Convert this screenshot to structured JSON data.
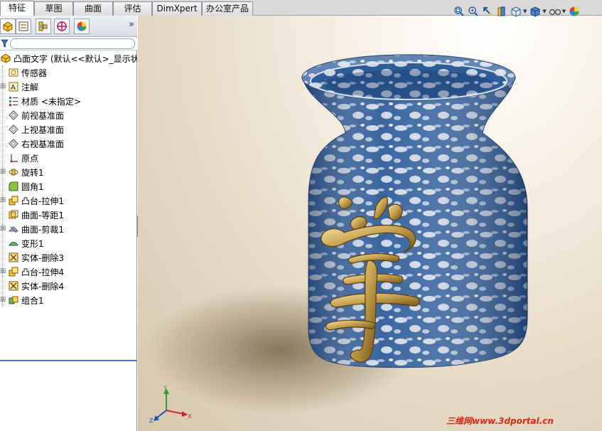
{
  "tabs": [
    {
      "label": "特征",
      "active": true
    },
    {
      "label": "草图",
      "active": false
    },
    {
      "label": "曲面",
      "active": false
    },
    {
      "label": "评估",
      "active": false
    },
    {
      "label": "DimXpert",
      "active": false
    },
    {
      "label": "办公室产品",
      "active": false
    }
  ],
  "panel": {
    "tabs": [
      "featuremanager-icon",
      "propertymanager-icon",
      "configurationmanager-icon",
      "dimxpertmanager-icon",
      "displaymanager-icon"
    ],
    "expand_label": "»"
  },
  "tree": {
    "root": "凸面文字 (默认<<默认>_显示状",
    "items": [
      {
        "label": "传感器",
        "icon": "sensor-icon"
      },
      {
        "label": "注解",
        "icon": "annotation-icon",
        "expandable": true
      },
      {
        "label": "材质 <未指定>",
        "icon": "material-icon"
      },
      {
        "label": "前视基准面",
        "icon": "plane-icon"
      },
      {
        "label": "上视基准面",
        "icon": "plane-icon"
      },
      {
        "label": "右视基准面",
        "icon": "plane-icon"
      },
      {
        "label": "原点",
        "icon": "origin-icon"
      },
      {
        "label": "旋转1",
        "icon": "revolve-icon",
        "expandable": true
      },
      {
        "label": "圆角1",
        "icon": "fillet-icon"
      },
      {
        "label": "凸台-拉伸1",
        "icon": "extrude-icon",
        "expandable": true
      },
      {
        "label": "曲面-等距1",
        "icon": "offset-surface-icon"
      },
      {
        "label": "曲面-剪裁1",
        "icon": "trim-surface-icon",
        "expandable": true
      },
      {
        "label": "变形1",
        "icon": "deform-icon"
      },
      {
        "label": "实体-删除3",
        "icon": "delete-body-icon"
      },
      {
        "label": "凸台-拉伸4",
        "icon": "extrude-icon",
        "expandable": true
      },
      {
        "label": "实体-删除4",
        "icon": "delete-body-icon"
      },
      {
        "label": "组合1",
        "icon": "combine-icon",
        "expandable": true
      }
    ]
  },
  "triad": {
    "x": "X",
    "y": "Y",
    "z": "Z"
  },
  "watermark": "三维网www.3dportal.cn",
  "colors": {
    "vase_blue": "#2f5d9a",
    "gold": "#c9a451",
    "selection_line": "#4a7dc0"
  }
}
